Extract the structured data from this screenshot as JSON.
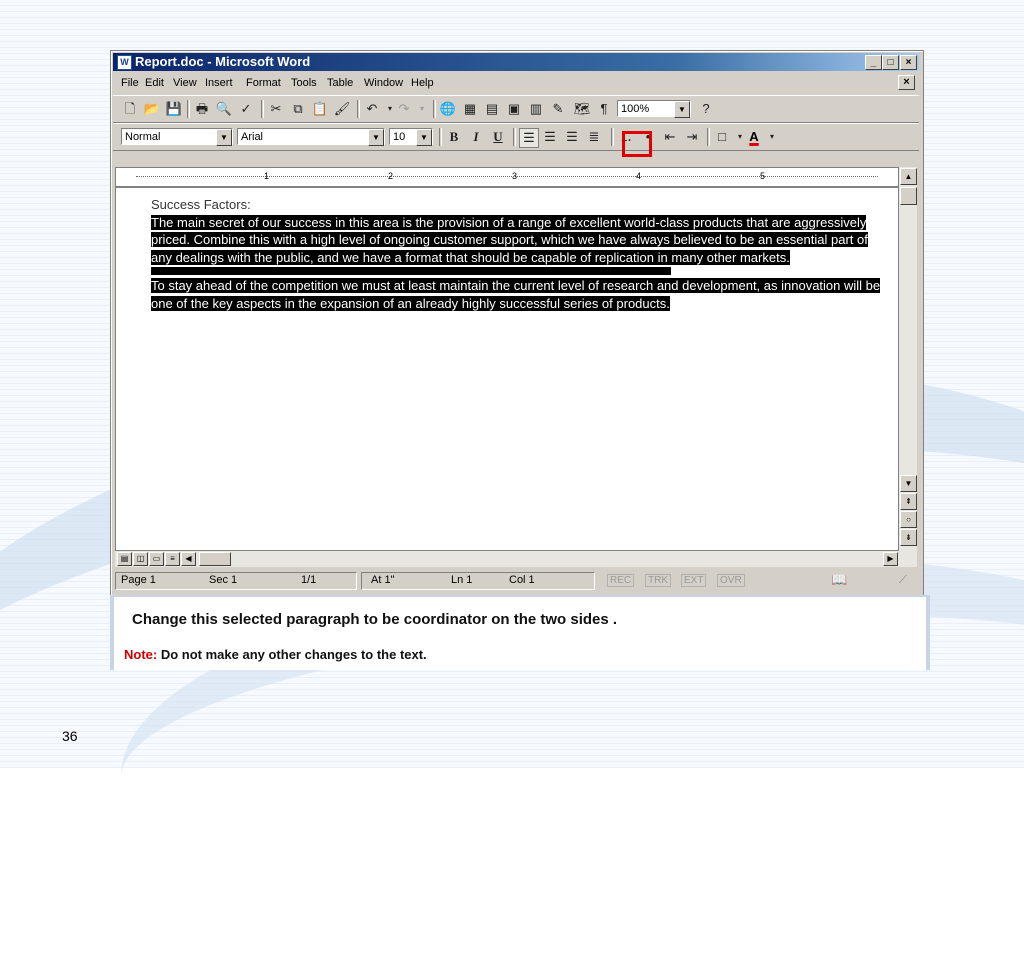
{
  "window": {
    "title": "Report.doc - Microsoft Word",
    "icon": "word-doc-icon",
    "controls": [
      "minimize-icon",
      "maximize-icon",
      "close-icon"
    ]
  },
  "menubar": {
    "items": [
      "File",
      "Edit",
      "View",
      "Insert",
      "Format",
      "Tools",
      "Table",
      "Window",
      "Help"
    ],
    "close_glyph": "×"
  },
  "standard_toolbar": {
    "buttons": [
      "new-icon",
      "open-icon",
      "save-icon",
      "print-icon",
      "print-preview-icon",
      "spelling-icon",
      "cut-icon",
      "copy-icon",
      "paste-icon",
      "format-painter-icon",
      "undo-icon",
      "redo-icon",
      "web-toolbar-icon",
      "tables-borders-icon",
      "insert-table-icon",
      "insert-excel-icon",
      "columns-icon",
      "drawing-icon",
      "document-map-icon",
      "show-formatting-icon",
      "help-icon"
    ],
    "zoom": "100%"
  },
  "formatting_toolbar": {
    "style": "Normal",
    "font": "Arial",
    "size": "10",
    "bold": "B",
    "italic": "I",
    "underline": "U"
  },
  "ruler": {
    "numbers": [
      "1",
      "2",
      "3",
      "4",
      "5"
    ]
  },
  "document": {
    "heading": "Success Factors:",
    "paragraph1": "The main secret of our success in this area is the provision of a range of excellent world-class products that are aggressively priced. Combine this with a high level of ongoing customer support, which we have always believed to be an essential part of any dealings with the public, and we have a format that should be capable of replication in many other markets.",
    "paragraph2": "To stay ahead of the competition we must at least maintain the current level of research and development, as innovation will be one of the key aspects in the expansion of an already highly successful series of products."
  },
  "statusbar": {
    "page": "Page 1",
    "sec": "Sec 1",
    "pages": "1/1",
    "at": "At 1\"",
    "ln": "Ln 1",
    "col": "Col 1",
    "rec": "REC",
    "trk": "TRK",
    "ext": "EXT",
    "ovr": "OVR"
  },
  "instruction": {
    "main": "Change this selected paragraph to be coordinator on the two sides .",
    "note_label": "Note:",
    "note_text": "Do not make any other changes to the text."
  },
  "slide": {
    "number": "36"
  },
  "colors": {
    "titlebar": "#0a246a",
    "highlight": "#e00000",
    "note_label": "#d00000",
    "chrome": "#d4d0c8"
  }
}
